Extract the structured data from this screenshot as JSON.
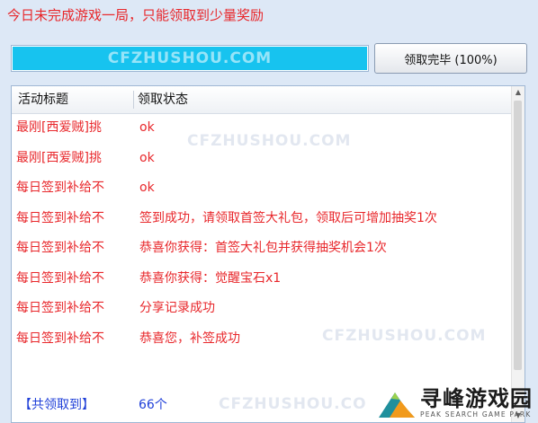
{
  "notice": "今日未完成游戏一局，只能领取到少量奖励",
  "progress": {
    "fraction": 1.0,
    "watermark": "CFZHUSHOU.COM",
    "color": "#17c3ef"
  },
  "done_button": "领取完毕 (100%)",
  "list": {
    "headers": [
      "活动标题",
      "领取状态"
    ],
    "rows": [
      {
        "title": "最刚[西爱贼]挑",
        "status": "ok"
      },
      {
        "title": "最刚[西爱贼]挑",
        "status": "ok"
      },
      {
        "title": "每日签到补给不",
        "status": "ok"
      },
      {
        "title": "每日签到补给不",
        "status": "签到成功，请领取首签大礼包，领取后可增加抽奖1次"
      },
      {
        "title": "每日签到补给不",
        "status": "恭喜你获得：首签大礼包并获得抽奖机会1次"
      },
      {
        "title": "每日签到补给不",
        "status": "恭喜你获得：觉醒宝石x1"
      },
      {
        "title": "每日签到补给不",
        "status": "分享记录成功"
      },
      {
        "title": "每日签到补给不",
        "status": "恭喜您，补签成功"
      }
    ],
    "footer": {
      "label": "【共领取到】",
      "value": "66个"
    }
  },
  "watermarks": [
    "CFZHUSHOU.COM",
    "CFZHUSHOU.COM",
    "CFZHUSHOU.CO"
  ],
  "logo": {
    "cn": "寻峰游戏园",
    "en": "PEAK SEARCH GAME PARK"
  },
  "colors": {
    "red_text": "#e8272b",
    "blue_text": "#1f3fd8",
    "background": "#dde8f6"
  }
}
